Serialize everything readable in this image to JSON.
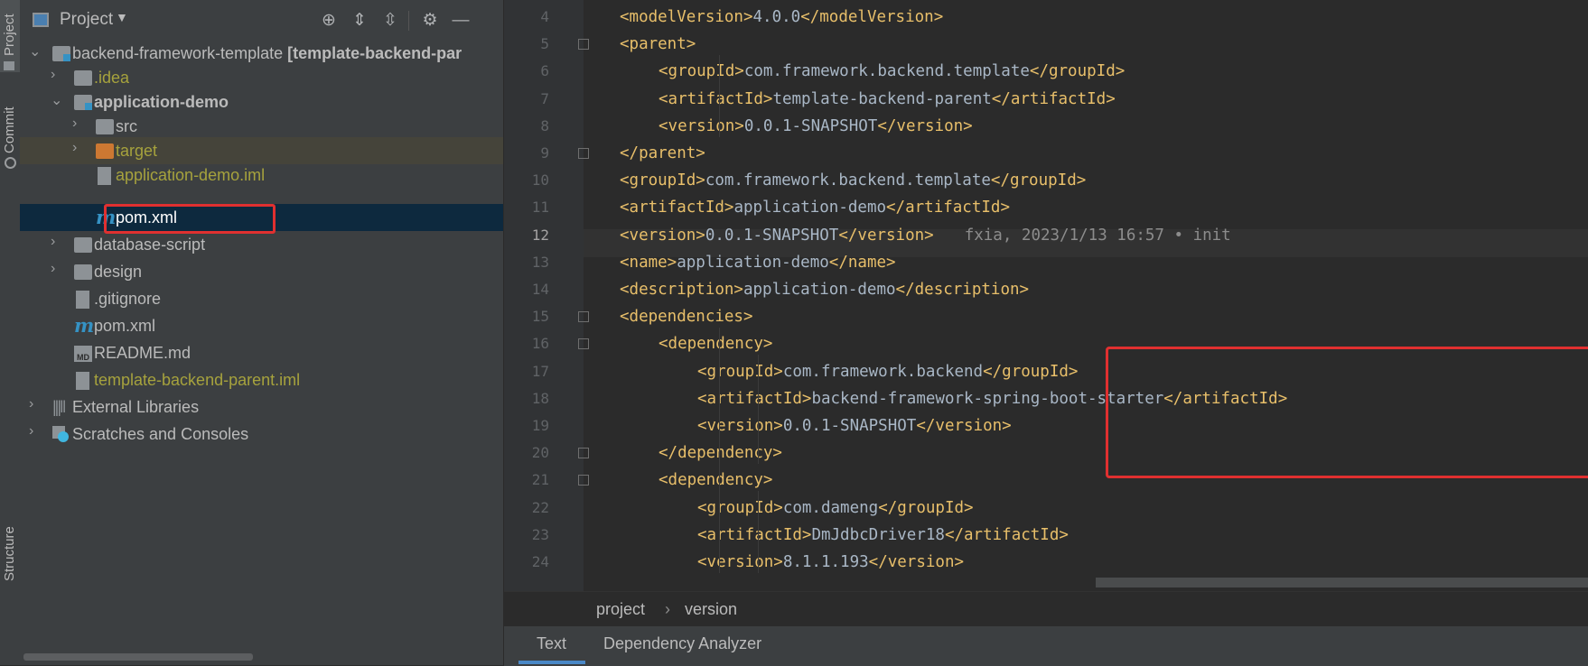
{
  "left_strip": {
    "tabs": [
      "Project",
      "Commit",
      "Structure"
    ]
  },
  "project_panel": {
    "title": "Project",
    "toolbar_icons": [
      "locate-icon",
      "expand-all-icon",
      "collapse-all-icon",
      "gear-icon",
      "minimize-icon"
    ],
    "tree": [
      {
        "label": "backend-framework-template",
        "extra": "[template-backend-par",
        "kind": "module",
        "color": "#bbbbbb"
      },
      {
        "label": ".idea",
        "kind": "folder",
        "color": "#a6a23d"
      },
      {
        "label": "application-demo",
        "kind": "module",
        "color": "#bbbbbb"
      },
      {
        "label": "src",
        "kind": "folder",
        "color": "#bbbbbb"
      },
      {
        "label": "target",
        "kind": "excluded-folder",
        "color": "#a6a23d"
      },
      {
        "label": "application-demo.iml",
        "kind": "iml",
        "color": "#a6a23d"
      },
      {
        "label": "pom.xml",
        "kind": "maven",
        "color": "#ffffff"
      },
      {
        "label": "database-script",
        "kind": "folder",
        "color": "#bbbbbb"
      },
      {
        "label": "design",
        "kind": "folder",
        "color": "#bbbbbb"
      },
      {
        "label": ".gitignore",
        "kind": "ignore",
        "color": "#bbbbbb"
      },
      {
        "label": "pom.xml",
        "kind": "maven",
        "color": "#bbbbbb"
      },
      {
        "label": "README.md",
        "kind": "markdown",
        "color": "#bbbbbb"
      },
      {
        "label": "template-backend-parent.iml",
        "kind": "iml",
        "color": "#a6a23d"
      },
      {
        "label": "External Libraries",
        "kind": "libraries",
        "color": "#bbbbbb"
      },
      {
        "label": "Scratches and Consoles",
        "kind": "scratches",
        "color": "#bbbbbb"
      }
    ]
  },
  "editor": {
    "line_numbers": [
      "4",
      "5",
      "6",
      "7",
      "8",
      "9",
      "10",
      "11",
      "12",
      "13",
      "14",
      "15",
      "16",
      "17",
      "18",
      "19",
      "20",
      "21",
      "22",
      "23",
      "24"
    ],
    "current_line": "12",
    "lines": [
      {
        "indent": 0,
        "open": "<modelVersion>",
        "text": "4.0.0",
        "close": "</modelVersion>"
      },
      {
        "indent": 0,
        "open": "<parent>",
        "text": "",
        "close": ""
      },
      {
        "indent": 1,
        "open": "<groupId>",
        "text": "com.framework.backend.template",
        "close": "</groupId>"
      },
      {
        "indent": 1,
        "open": "<artifactId>",
        "text": "template-backend-parent",
        "close": "</artifactId>"
      },
      {
        "indent": 1,
        "open": "<version>",
        "text": "0.0.1-SNAPSHOT",
        "close": "</version>"
      },
      {
        "indent": 0,
        "open": "</parent>",
        "text": "",
        "close": ""
      },
      {
        "indent": 0,
        "open": "<groupId>",
        "text": "com.framework.backend.template",
        "close": "</groupId>"
      },
      {
        "indent": 0,
        "open": "<artifactId>",
        "text": "application-demo",
        "close": "</artifactId>"
      },
      {
        "indent": 0,
        "open": "<version>",
        "text": "0.0.1-SNAPSHOT",
        "close": "</version>",
        "annotation": "fxia, 2023/1/13 16:57 • init"
      },
      {
        "indent": 0,
        "open": "<name>",
        "text": "application-demo",
        "close": "</name>"
      },
      {
        "indent": 0,
        "open": "<description>",
        "text": "application-demo",
        "close": "</description>"
      },
      {
        "indent": 0,
        "open": "<dependencies>",
        "text": "",
        "close": ""
      },
      {
        "indent": 1,
        "open": "<dependency>",
        "text": "",
        "close": ""
      },
      {
        "indent": 2,
        "open": "<groupId>",
        "text": "com.framework.backend",
        "close": "</groupId>"
      },
      {
        "indent": 2,
        "open": "<artifactId>",
        "text": "backend-framework-spring-boot-starter",
        "close": "</artifactId>"
      },
      {
        "indent": 2,
        "open": "<version>",
        "text": "0.0.1-SNAPSHOT",
        "close": "</version>"
      },
      {
        "indent": 1,
        "open": "</dependency>",
        "text": "",
        "close": ""
      },
      {
        "indent": 1,
        "open": "<dependency>",
        "text": "",
        "close": ""
      },
      {
        "indent": 2,
        "open": "<groupId>",
        "text": "com.dameng",
        "close": "</groupId>"
      },
      {
        "indent": 2,
        "open": "<artifactId>",
        "text": "DmJdbcDriver18",
        "close": "</artifactId>"
      },
      {
        "indent": 2,
        "open": "<version>",
        "text": "8.1.1.193",
        "close": "</version>"
      }
    ]
  },
  "breadcrumb": {
    "items": [
      "project",
      "version"
    ]
  },
  "bottom_tabs": {
    "items": [
      "Text",
      "Dependency Analyzer"
    ],
    "active": "Text"
  },
  "colors": {
    "highlight_box": "#e03030",
    "tag": "#e8bf6a",
    "text": "#a9b7c6",
    "selection": "#0d293e",
    "excluded_row": "#45443a"
  }
}
